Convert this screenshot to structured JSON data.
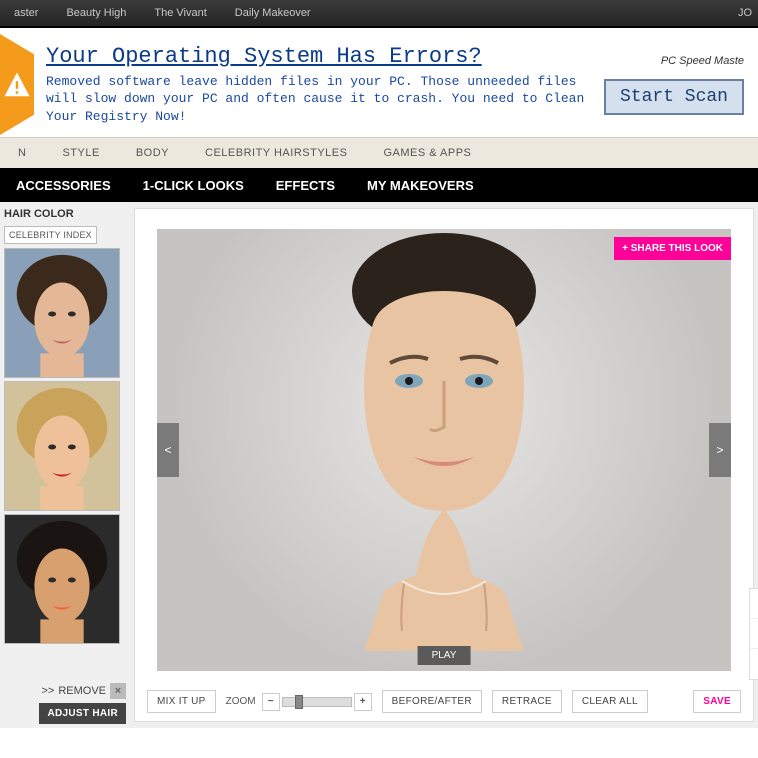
{
  "topbar": {
    "items": [
      "aster",
      "Beauty High",
      "The Vivant",
      "Daily Makeover"
    ],
    "right": "JO"
  },
  "ad": {
    "headline": "Your Operating System Has Errors?",
    "body": "Removed software leave hidden files in your PC. Those unneeded files will slow down your PC and often cause it to crash. You need to Clean Your Registry Now!",
    "product": "PC Speed Maste",
    "cta": "Start Scan"
  },
  "nav2": {
    "items": [
      "N",
      "STYLE",
      "BODY",
      "CELEBRITY HAIRSTYLES",
      "GAMES & APPS"
    ]
  },
  "nav3": {
    "items": [
      "ACCESSORIES",
      "1-CLICK LOOKS",
      "EFFECTS",
      "MY MAKEOVERS"
    ]
  },
  "sidebar": {
    "heading": "HAIR COLOR",
    "tab": "CELEBRITY INDEX",
    "thumbs": [
      {
        "name": "celeb-1",
        "hair": "#3b2a1c",
        "skin": "#e4b896",
        "bg": "#8aa0b8"
      },
      {
        "name": "celeb-2",
        "hair": "#caa35a",
        "skin": "#eec19a",
        "bg": "#d2c29c",
        "lips": "#d31f2a"
      },
      {
        "name": "celeb-3",
        "hair": "#1a1412",
        "skin": "#d9a06f",
        "bg": "#2b2b2b",
        "lips": "#ff5a36"
      }
    ],
    "remove_prefix": ">>",
    "remove": "REMOVE",
    "adjust": "ADJUST HAIR"
  },
  "canvas": {
    "share": "+ SHARE THIS LOOK",
    "prev": "<",
    "next": ">",
    "play": "PLAY"
  },
  "toolbar": {
    "mix": "MIX IT UP",
    "zoom_label": "ZOOM",
    "before_after": "BEFORE/AFTER",
    "retrace": "RETRACE",
    "clear": "CLEAR ALL",
    "save": "SAVE"
  },
  "colors": {
    "accent": "#ff0099"
  }
}
